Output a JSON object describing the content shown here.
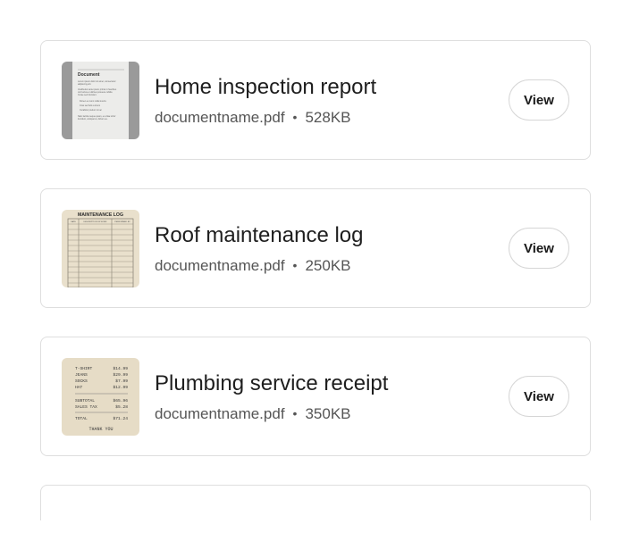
{
  "documents": [
    {
      "title": "Home inspection report",
      "filename": "documentname.pdf",
      "separator": "•",
      "size": "528KB",
      "action_label": "View",
      "thumbnail": "document-preview-icon"
    },
    {
      "title": "Roof maintenance log",
      "filename": "documentname.pdf",
      "separator": "•",
      "size": "250KB",
      "action_label": "View",
      "thumbnail": "maintenance-log-preview-icon"
    },
    {
      "title": "Plumbing service receipt",
      "filename": "documentname.pdf",
      "separator": "•",
      "size": "350KB",
      "action_label": "View",
      "thumbnail": "receipt-preview-icon"
    }
  ],
  "thumbnails": {
    "doc": {
      "heading": "Document",
      "lines": [
        "Lorem ipsum dolor sit amet, consectetur",
        "adipiscing elit.",
        "Vestibulum ante ipsum primis in faucibus",
        "orci luctus et ultrices posuere cubilia",
        "Curae sed tincidunt.",
        "Donec eu nunc nulla viverra",
        "Cras sed felis a lorem",
        "Curabitur pretium mi ac",
        "Nam lacinia neque quam, eu vitae tortor",
        "tincidunt, volutpat ut, dictum eu."
      ]
    },
    "log": {
      "heading": "MAINTENANCE LOG",
      "columns": [
        "DATE",
        "DESCRIPTION OF WORK",
        "PERFORMED BY"
      ]
    },
    "receipt": {
      "items": [
        {
          "name": "T-SHIRT",
          "price": "$14.99"
        },
        {
          "name": "JEANS",
          "price": "$29.99"
        },
        {
          "name": "SOCKS",
          "price": "$7.99"
        },
        {
          "name": "HAT",
          "price": "$12.99"
        }
      ],
      "subtotal_label": "SUBTOTAL",
      "subtotal": "$65.96",
      "tax_label": "SALES TAX",
      "tax": "$5.28",
      "total_label": "TOTAL",
      "total": "$71.24",
      "footer": "THANK YOU"
    }
  },
  "colors": {
    "card_border": "#dedede",
    "button_border": "#d6d6d6",
    "meta_text": "#555555",
    "paper": "#efe6d4"
  }
}
